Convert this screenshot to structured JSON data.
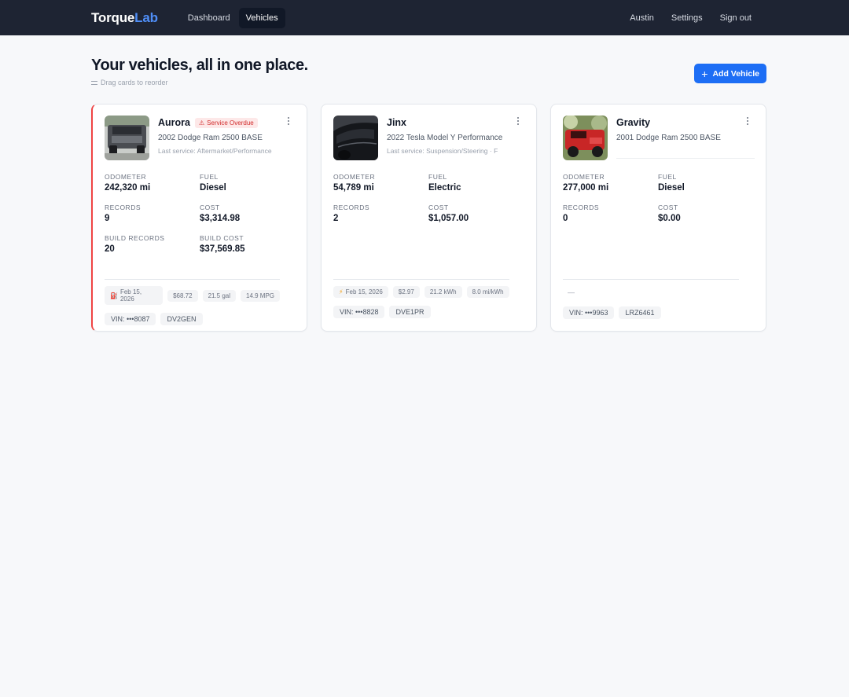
{
  "nav": {
    "brand_part1": "Torque",
    "brand_part2": "Lab",
    "links": [
      "Dashboard",
      "Vehicles"
    ],
    "user": "Austin",
    "settings": "Settings",
    "signout": "Sign out"
  },
  "page": {
    "title": "Your vehicles, all in one place.",
    "drag_hint": "Drag cards to reorder",
    "add_button": "Add Vehicle"
  },
  "labels": {
    "odometer": "ODOMETER",
    "fuel": "FUEL",
    "records": "RECORDS",
    "cost": "COST",
    "build_records": "BUILD RECORDS",
    "build_cost": "BUILD COST"
  },
  "vehicles": [
    {
      "name": "Aurora",
      "badge": "Service Overdue",
      "model": "2002 Dodge Ram 2500 BASE",
      "last_service": "Last service: Aftermarket/Performance",
      "odometer": "242,320 mi",
      "fuel": "Diesel",
      "records": "9",
      "cost": "$3,314.98",
      "build_records": "20",
      "build_cost": "$37,569.85",
      "fill_date": "Feb 15, 2026",
      "fill_cost": "$68.72",
      "fill_amount": "21.5 gal",
      "efficiency": "14.9 MPG",
      "vin": "VIN: •••8087",
      "plate": "DV2GEN"
    },
    {
      "name": "Jinx",
      "model": "2022 Tesla Model Y Performance",
      "last_service": "Last service: Suspension/Steering · F",
      "odometer": "54,789 mi",
      "fuel": "Electric",
      "records": "2",
      "cost": "$1,057.00",
      "fill_date": "Feb 15, 2026",
      "fill_cost": "$2.97",
      "fill_amount": "21.2 kWh",
      "efficiency": "8.0 mi/kWh",
      "vin": "VIN: •••8828",
      "plate": "DVE1PR"
    },
    {
      "name": "Gravity",
      "model": "2001 Dodge Ram 2500 BASE",
      "odometer": "277,000 mi",
      "fuel": "Diesel",
      "records": "0",
      "cost": "$0.00",
      "empty_fill": "—",
      "vin": "VIN: •••9963",
      "plate": "LRZ6461"
    }
  ]
}
